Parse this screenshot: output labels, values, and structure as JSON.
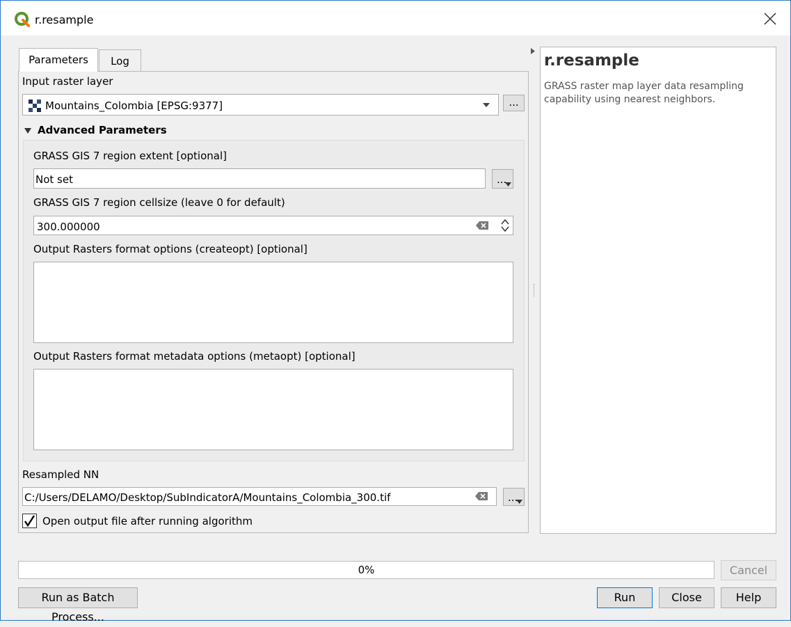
{
  "window": {
    "title": "r.resample"
  },
  "tabs": [
    {
      "label": "Parameters"
    },
    {
      "label": "Log"
    }
  ],
  "params": {
    "input_label": "Input raster layer",
    "input_value": "Mountains_Colombia [EPSG:9377]",
    "browse_label": "...",
    "advanced_label": "Advanced Parameters",
    "extent_label": "GRASS GIS 7 region extent [optional]",
    "extent_value": "Not set",
    "cellsize_label": "GRASS GIS 7 region cellsize (leave 0 for default)",
    "cellsize_value": "300.000000",
    "createopt_label": "Output Rasters format options (createopt) [optional]",
    "metaopt_label": "Output Rasters format metadata options (metaopt) [optional]",
    "output_label": "Resampled NN",
    "output_value": "C:/Users/DELAMO/Desktop/SubIndicatorA/Mountains_Colombia_300.tif",
    "open_output_label": "Open output file after running algorithm",
    "open_output_checked": true
  },
  "help": {
    "title": "r.resample",
    "description": "GRASS raster map layer data resampling capability using nearest neighbors."
  },
  "footer": {
    "progress_text": "0%",
    "progress_value": 0,
    "cancel_label": "Cancel",
    "batch_label": "Run as Batch Process...",
    "run_label": "Run",
    "close_label": "Close",
    "help_label": "Help"
  }
}
